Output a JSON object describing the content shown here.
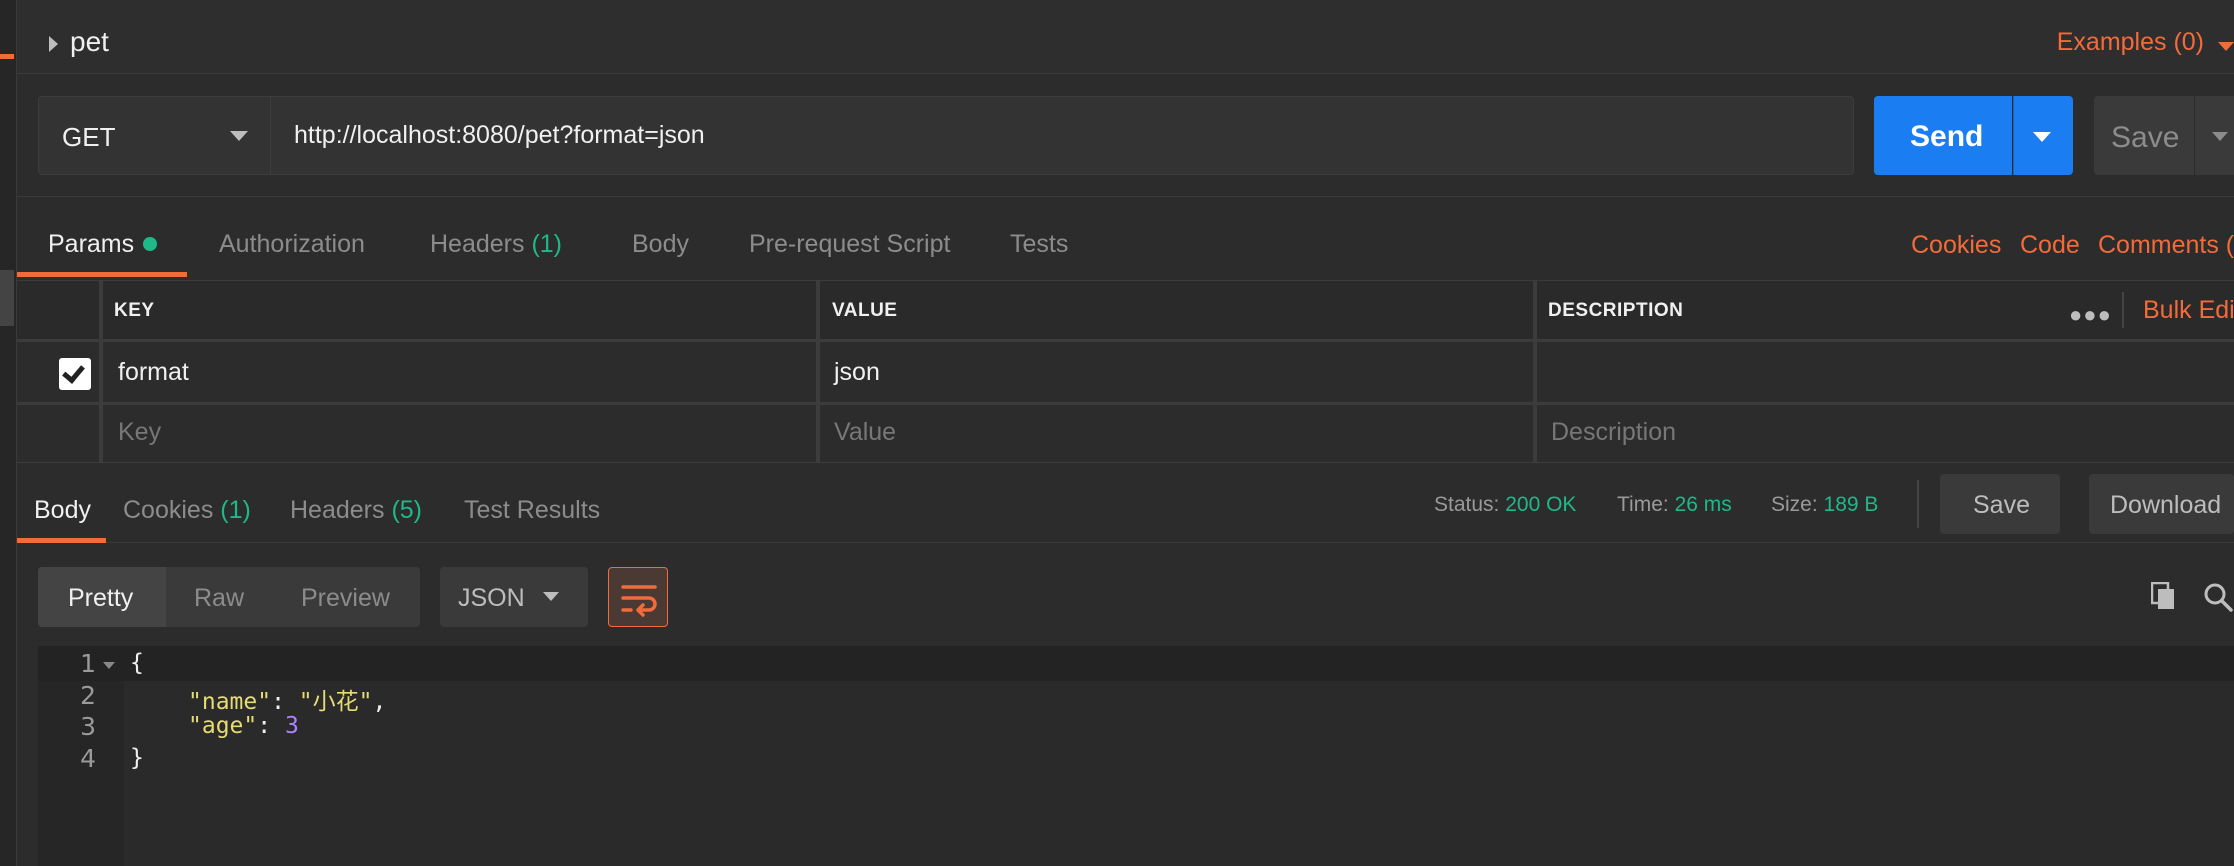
{
  "request": {
    "name": "pet",
    "examples_label": "Examples (0)",
    "method": "GET",
    "url": "http://localhost:8080/pet?format=json",
    "send_label": "Send",
    "save_label": "Save"
  },
  "request_tabs": [
    {
      "label": "Params",
      "count": "",
      "active": true
    },
    {
      "label": "Authorization",
      "count": ""
    },
    {
      "label": "Headers",
      "count": "(1)"
    },
    {
      "label": "Body",
      "count": ""
    },
    {
      "label": "Pre-request Script",
      "count": ""
    },
    {
      "label": "Tests",
      "count": ""
    }
  ],
  "request_links": {
    "cookies": "Cookies",
    "code": "Code",
    "comments": "Comments ("
  },
  "params_table": {
    "headers": {
      "key": "KEY",
      "value": "VALUE",
      "description": "DESCRIPTION"
    },
    "bulk_edit": "Bulk Edi",
    "rows": [
      {
        "checked": true,
        "key": "format",
        "value": "json",
        "description": ""
      }
    ],
    "placeholders": {
      "key": "Key",
      "value": "Value",
      "description": "Description"
    }
  },
  "response_tabs": [
    {
      "label": "Body",
      "count": "",
      "active": true
    },
    {
      "label": "Cookies",
      "count": "(1)"
    },
    {
      "label": "Headers",
      "count": "(5)"
    },
    {
      "label": "Test Results",
      "count": ""
    }
  ],
  "response_meta": {
    "status_label": "Status:",
    "status": "200 OK",
    "time_label": "Time:",
    "time": "26 ms",
    "size_label": "Size:",
    "size": "189 B",
    "save_label": "Save",
    "download_label": "Download"
  },
  "view_modes": {
    "pretty": "Pretty",
    "raw": "Raw",
    "preview": "Preview",
    "format": "JSON"
  },
  "code": {
    "line_numbers": [
      "1",
      "2",
      "3",
      "4"
    ],
    "open_brace": "{",
    "name_key": "\"name\"",
    "name_value": "\"小花\"",
    "age_key": "\"age\"",
    "age_value": "3",
    "close_brace": "}"
  },
  "colors": {
    "accent": "#f26b3a",
    "primary": "#1a7ef2",
    "success": "#1fb888"
  }
}
